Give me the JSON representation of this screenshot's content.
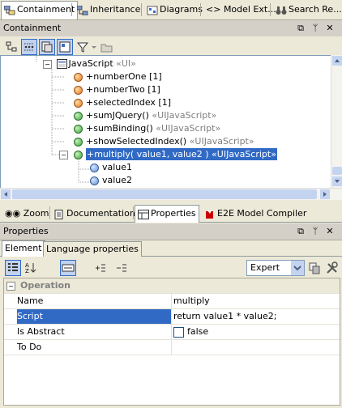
{
  "top_tabs": [
    {
      "label": "Containment",
      "active": true
    },
    {
      "label": "Inheritance",
      "active": false
    },
    {
      "label": "Diagrams",
      "active": false
    },
    {
      "label": "Model Ext...",
      "active": false
    },
    {
      "label": "Search Re...",
      "active": false
    }
  ],
  "top_tab_icons": {
    "model_ext": "<>"
  },
  "containment_panel": {
    "title": "Containment"
  },
  "tree": {
    "parent": {
      "label": "JavaScript",
      "stereotype": "«UI»"
    },
    "items": [
      {
        "label": "+numberOne [1]",
        "icon": "orange"
      },
      {
        "label": "+numberTwo [1]",
        "icon": "orange"
      },
      {
        "label": "+selectedIndex [1]",
        "icon": "orange"
      },
      {
        "label": "+sumJQuery()",
        "stereotype": "«UIJavaScript»",
        "icon": "green"
      },
      {
        "label": "+sumBinding()",
        "stereotype": "«UIJavaScript»",
        "icon": "green"
      },
      {
        "label": "+showSelectedIndex()",
        "stereotype": "«UIJavaScript»",
        "icon": "green"
      },
      {
        "label": "+multiply( value1, value2 )",
        "stereotype": "«UIJavaScript»",
        "icon": "green",
        "selected": true
      }
    ],
    "params": [
      {
        "label": "value1"
      },
      {
        "label": "value2"
      }
    ]
  },
  "bottom_tabs": [
    {
      "label": "Zoom"
    },
    {
      "label": "Documentation"
    },
    {
      "label": "Properties",
      "active": true
    },
    {
      "label": "E2E Model Compiler"
    }
  ],
  "properties_panel": {
    "title": "Properties"
  },
  "sub_tabs": [
    {
      "label": "Element",
      "active": true
    },
    {
      "label": "Language properties",
      "active": false
    }
  ],
  "filter_select": {
    "value": "Expert"
  },
  "table": {
    "section": "Operation",
    "rows": [
      {
        "name": "Name",
        "value": "multiply"
      },
      {
        "name": "Script",
        "value": "return value1 * value2;",
        "selected": true
      },
      {
        "name": "Is Abstract",
        "value": "false",
        "checkbox": true
      },
      {
        "name": "To Do",
        "value": ""
      }
    ]
  },
  "colors": {
    "selection": "#316ac5",
    "panel_bg": "#ece9d8"
  }
}
